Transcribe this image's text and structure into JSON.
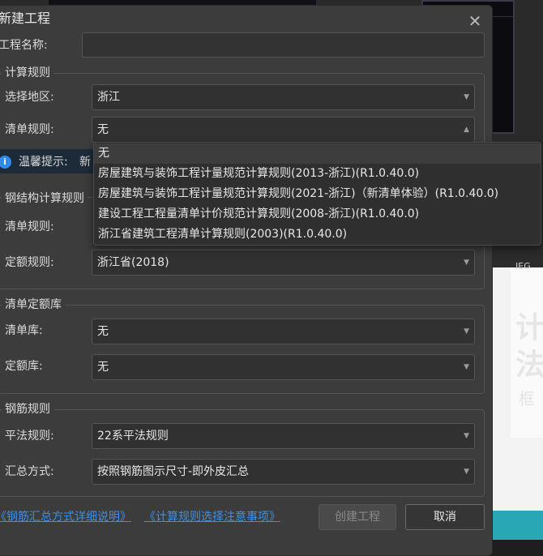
{
  "dialog": {
    "title": "新建工程",
    "close_glyph": "✕",
    "project_name_label": "工程名称:",
    "project_name_value": ""
  },
  "calc_rules": {
    "group_title": "计算规则",
    "region_label": "选择地区:",
    "region_value": "浙江",
    "bill_rule_label": "清单规则:",
    "bill_rule_value": "无",
    "tip_label": "温馨提示:",
    "tip_text": "新",
    "tip_icon": "info-icon"
  },
  "bill_rule_dropdown": {
    "options": [
      "无",
      "房屋建筑与装饰工程计量规范计算规则(2013-浙江)(R1.0.40.0)",
      "房屋建筑与装饰工程计量规范计算规则(2021-浙江)（新清单体验）(R1.0.40.0)",
      "建设工程工程量清单计价规范计算规则(2008-浙江)(R1.0.40.0)",
      "浙江省建筑工程清单计算规则(2003)(R1.0.40.0)"
    ],
    "selected": "无"
  },
  "steel_rules": {
    "group_title": "钢结构计算规则",
    "bill_rule_label": "清单规则:",
    "quota_rule_label": "定额规则:",
    "quota_rule_value": "浙江省(2018)"
  },
  "bill_quota_lib": {
    "group_title": "清单定额库",
    "bill_lib_label": "清单库:",
    "bill_lib_value": "无",
    "quota_lib_label": "定额库:",
    "quota_lib_value": "无"
  },
  "rebar_rules": {
    "group_title": "钢筋规则",
    "flat_rule_label": "平法规则:",
    "flat_rule_value": "22系平法规则",
    "summary_label": "汇总方式:",
    "summary_value": "按照钢筋图示尺寸-即外皮汇总"
  },
  "footer": {
    "link1": "《钢筋汇总方式详细说明》",
    "link2": "《计算规则选择注意事项》",
    "create_button": "创建工程",
    "cancel_button": "取消"
  },
  "background": {
    "right_big_text": "计 法",
    "right_small_text": "框",
    "right_top_text": "IEG"
  },
  "colors": {
    "dialog_bg": "#3c3c3c",
    "link": "#3d8fe6",
    "info_icon": "#2f8bf0"
  }
}
